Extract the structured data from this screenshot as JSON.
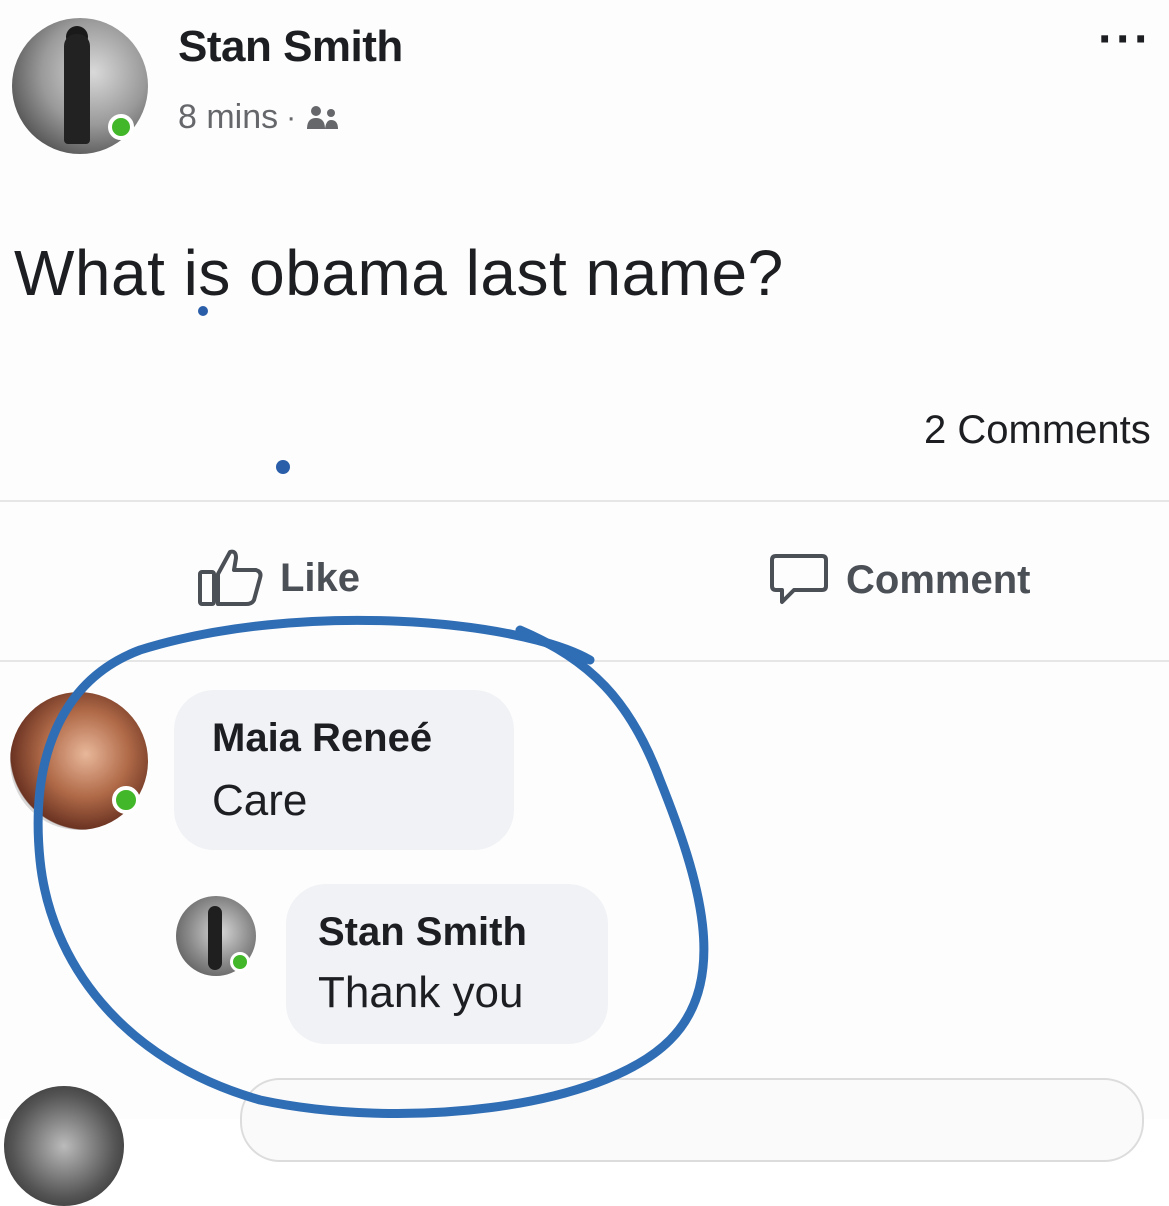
{
  "post": {
    "author": "Stan Smith",
    "time": "8 mins",
    "separator": "·",
    "privacy_icon": "friends-icon",
    "more": "···",
    "text": "What is obama last name?",
    "comment_count": "2 Comments"
  },
  "actions": {
    "like_label": "Like",
    "comment_label": "Comment"
  },
  "comments": [
    {
      "author": "Maia Reneé",
      "text": "Care"
    },
    {
      "author": "Stan Smith",
      "text": "Thank you"
    }
  ],
  "colors": {
    "online": "#42b72a",
    "annotation": "#2f6db5",
    "bubble": "#f0f2f5"
  }
}
